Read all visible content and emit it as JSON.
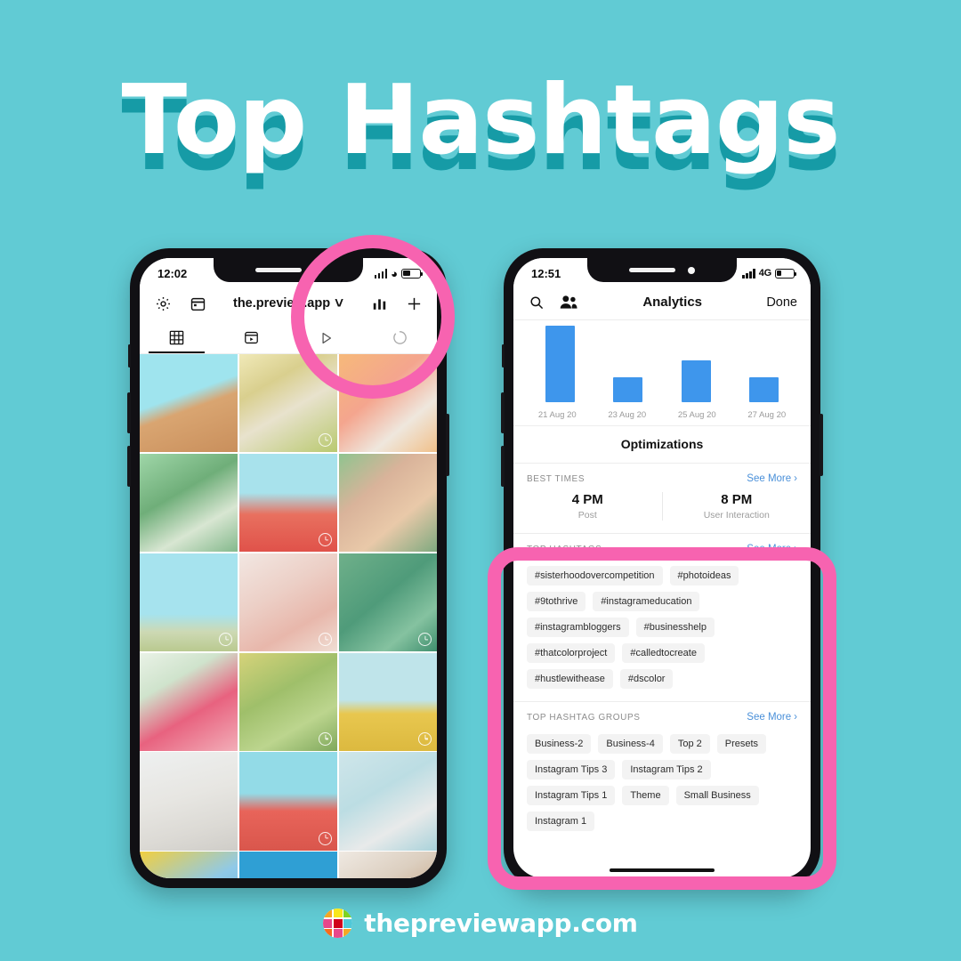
{
  "poster": {
    "title": "Top Hashtags",
    "background_color": "#61cbd4",
    "title_color": "#ffffff",
    "title_shadow_color": "#169ba6",
    "highlight_color": "#f763b0"
  },
  "brand": {
    "name": "thepreviewapp.com",
    "logo_icon": "grid-logo-icon"
  },
  "phone_left": {
    "status": {
      "time": "12:02",
      "network_icon": "signal-bars-icon",
      "wifi_icon": "wifi-icon",
      "battery_icon": "battery-icon"
    },
    "header": {
      "settings_icon": "gear-icon",
      "calendar_icon": "calendar-icon",
      "account": "the.preview.app",
      "chevron": "⌄",
      "analytics_icon": "bar-chart-icon",
      "add_icon": "plus-icon"
    },
    "tabs": [
      {
        "name": "grid",
        "icon": "grid-icon",
        "active": true
      },
      {
        "name": "reels",
        "icon": "reels-icon",
        "active": false
      },
      {
        "name": "video",
        "icon": "play-icon",
        "active": false
      },
      {
        "name": "loading",
        "icon": "spinner-icon",
        "active": false
      }
    ],
    "grid_cells": [
      {
        "badge": false,
        "g": "linear-gradient(160deg,#9fe4ee 0%,#9fe4ee 42%,#d9a571 55%,#c98f5c 100%)"
      },
      {
        "badge": true,
        "g": "linear-gradient(150deg,#f0e9b8 0%,#d9cf8e 30%,#e8e2cd 55%,#b9c96f 100%)"
      },
      {
        "badge": false,
        "g": "linear-gradient(140deg,#f6b97a 0%,#f4a58e 40%,#efe7dd 70%,#f0c08a 100%)"
      },
      {
        "badge": false,
        "g": "linear-gradient(150deg,#9fd6a8 0%,#6fae79 40%,#d8e6d2 70%,#84b98c 100%)"
      },
      {
        "badge": true,
        "g": "linear-gradient(180deg,#a8e2ec 0%,#a8e2ec 40%,#e8705f 62%,#e0524a 100%)"
      },
      {
        "badge": false,
        "g": "linear-gradient(140deg,#8fc48f 0%,#d9b39a 35%,#e9c9a9 65%,#7fa97f 100%)"
      },
      {
        "badge": true,
        "g": "linear-gradient(180deg,#a6e3ee 0%,#a6e3ee 62%,#cdd9b4 80%,#b9c98f 100%)"
      },
      {
        "badge": true,
        "g": "linear-gradient(150deg,#f2e7e2 0%,#eccfc6 40%,#e8b7ab 70%,#f0ded4 100%)"
      },
      {
        "badge": true,
        "g": "linear-gradient(140deg,#6fb08a 0%,#4f9b7a 45%,#85c2a0 75%,#3f8f6e 100%)"
      },
      {
        "badge": false,
        "g": "linear-gradient(150deg,#e9f2e6 0%,#cfe3cc 30%,#e8627f 60%,#f2aeb8 100%)"
      },
      {
        "badge": true,
        "g": "linear-gradient(150deg,#d6d37a 0%,#9fbf6a 40%,#bcd58e 70%,#7fa85c 100%)"
      },
      {
        "badge": true,
        "g": "linear-gradient(180deg,#bfe4ea 0%,#bfe4ea 48%,#e8c74f 62%,#dcb93f 100%)"
      },
      {
        "badge": false,
        "g": "linear-gradient(165deg,#eef0f0 0%,#e7e6e2 45%,#dcdad5 75%,#cfcdc8 100%)"
      },
      {
        "badge": true,
        "g": "linear-gradient(180deg,#93dbe7 0%,#93dbe7 42%,#e8645a 60%,#d9564c 100%)"
      },
      {
        "badge": false,
        "g": "linear-gradient(150deg,#cfe6ea 0%,#bcdde3 40%,#e8eaea 70%,#a9d2da 100%)"
      },
      {
        "badge": false,
        "g": "linear-gradient(150deg,#f2cf3f 0%,#8fc9e8 45%,#6fb8e0 75%,#f0d96a 100%)"
      },
      {
        "badge": false,
        "g": "linear-gradient(180deg,#2f9fd4 0%,#2f9fd4 55%,#1a1a1a 70%,#101010 100%)"
      },
      {
        "badge": false,
        "g": "linear-gradient(150deg,#efe9e2 0%,#dccfc0 35%,#c8a98a 65%,#e4d9c8 100%)"
      }
    ]
  },
  "phone_right": {
    "status": {
      "time": "12:51",
      "network_label": "4G",
      "network_icon": "signal-bars-icon",
      "battery_icon": "battery-icon"
    },
    "header": {
      "search_icon": "search-icon",
      "people_icon": "people-icon",
      "title": "Analytics",
      "done_label": "Done"
    },
    "chart_data": {
      "type": "bar",
      "title": "",
      "xlabel": "",
      "ylabel": "",
      "categories": [
        "21 Aug 20",
        "23 Aug 20",
        "25 Aug 20",
        "27 Aug 20"
      ],
      "tick_labels": [
        "21 Aug 20",
        "23 Aug 20",
        "25 Aug 20",
        "27 Aug 20"
      ],
      "values": [
        100,
        33,
        55,
        33
      ],
      "ylim": [
        0,
        100
      ],
      "grid": false,
      "legend": "none",
      "bar_color": "#3e96ec"
    },
    "optimizations_title": "Optimizations",
    "best_times": {
      "label": "BEST TIMES",
      "see_more": "See More",
      "chevron": "›",
      "columns": [
        {
          "time": "4 PM",
          "caption": "Post"
        },
        {
          "time": "8 PM",
          "caption": "User Interaction"
        }
      ]
    },
    "top_hashtags": {
      "label": "TOP HASHTAGS",
      "see_more": "See More",
      "chevron": "›",
      "tags": [
        "#sisterhoodovercompetition",
        "#photoideas",
        "#9tothrive",
        "#instagrameducation",
        "#instagrambloggers",
        "#businesshelp",
        "#thatcolorproject",
        "#calledtocreate",
        "#hustlewithease",
        "#dscolor"
      ]
    },
    "top_hashtag_groups": {
      "label": "TOP HASHTAG GROUPS",
      "see_more": "See More",
      "chevron": "›",
      "groups": [
        "Business-2",
        "Business-4",
        "Top 2",
        "Presets",
        "Instagram Tips 3",
        "Instagram Tips 2",
        "Instagram Tips 1",
        "Theme",
        "Small Business",
        "Instagram 1"
      ]
    }
  }
}
